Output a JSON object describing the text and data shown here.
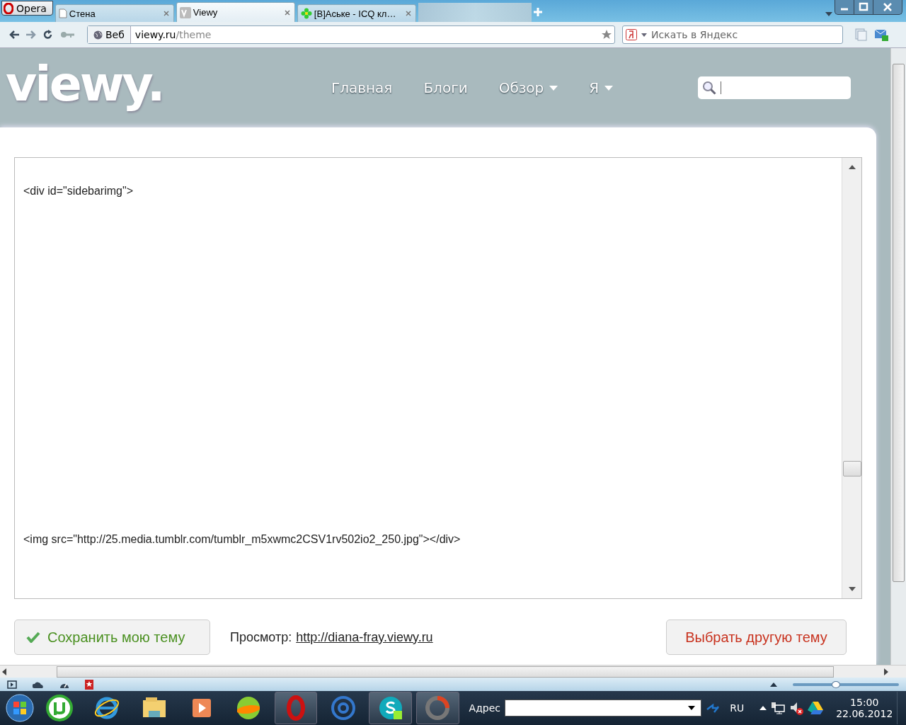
{
  "browser": {
    "menu_button": "Opera",
    "tabs": [
      {
        "title": "Стена",
        "selected": false
      },
      {
        "title": "Viewy",
        "selected": true
      },
      {
        "title": "[B]Аське - ICQ кл…",
        "selected": false
      }
    ],
    "address": {
      "badge": "Веб",
      "host": "viewy.ru",
      "path": "/theme"
    },
    "search": {
      "placeholder": "Искать в Яндекс"
    }
  },
  "site": {
    "logo": "viewy.",
    "nav": [
      {
        "label": "Главная",
        "dropdown": false
      },
      {
        "label": "Блоги",
        "dropdown": false
      },
      {
        "label": "Обзор",
        "dropdown": true
      },
      {
        "label": "Я",
        "dropdown": true
      }
    ],
    "editor": {
      "lines": [
        "<div id=\"sidebarimg\">",
        "<img src=\"http://25.media.tumblr.com/tumblr_m5xwmc2CSV1rv502io2_250.jpg\"></div>"
      ]
    },
    "save_button": "Сохранить мою тему",
    "preview_label": "Просмотр:",
    "preview_link": "http://diana-fray.viewy.ru",
    "choose_button": "Выбрать другую тему"
  },
  "status_bar": {
    "zoom": {
      "level": 0.4
    }
  },
  "taskbar": {
    "address_label": "Адрес",
    "language": "RU",
    "time": "15:00",
    "date": "22.06.2012"
  }
}
